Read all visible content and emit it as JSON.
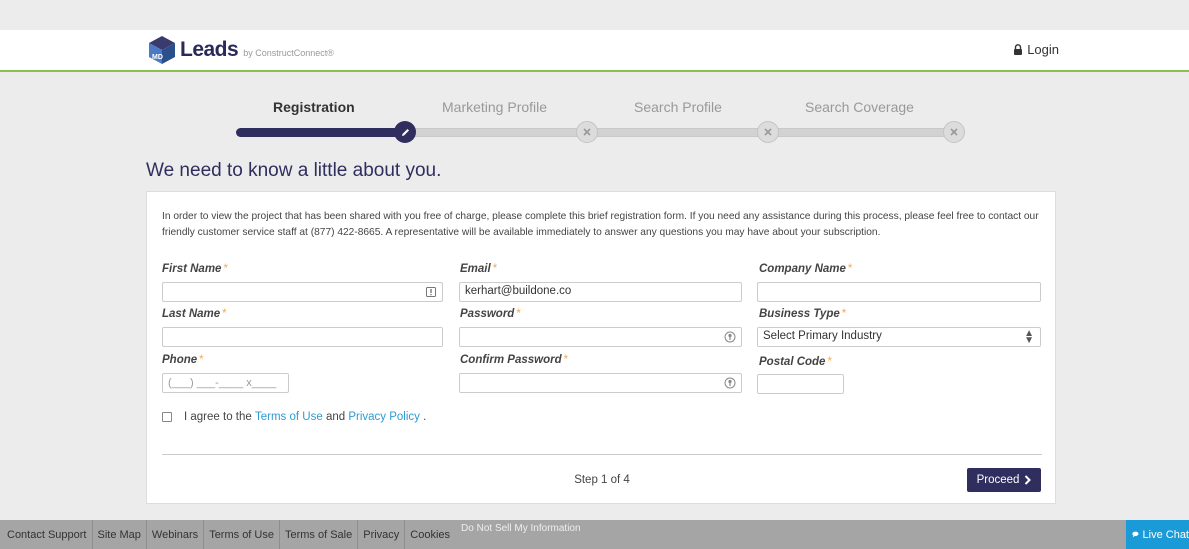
{
  "header": {
    "logo_word": "Leads",
    "logo_byline": "by ConstructConnect®",
    "logo_cube_letters": "MD",
    "login_label": "Login"
  },
  "steps": [
    {
      "label": "Registration",
      "state": "active"
    },
    {
      "label": "Marketing Profile",
      "state": "todo"
    },
    {
      "label": "Search Profile",
      "state": "todo"
    },
    {
      "label": "Search Coverage",
      "state": "todo"
    }
  ],
  "heading": "We need to know a little about you.",
  "intro": "In order to view the project that has been shared with you free of charge, please complete this brief registration form. If you need any assistance during this process, please feel free to contact our friendly customer service staff at (877) 422-8665. A representative will be available immediately to answer any questions you may have about your subscription.",
  "form": {
    "required_mark": "*",
    "first_name": {
      "label": "First Name",
      "value": ""
    },
    "last_name": {
      "label": "Last Name",
      "value": ""
    },
    "phone": {
      "label": "Phone",
      "mask": "(___) ___-____ x____"
    },
    "email": {
      "label": "Email",
      "value": "kerhart@buildone.co"
    },
    "password": {
      "label": "Password",
      "value": ""
    },
    "confirm_password": {
      "label": "Confirm Password",
      "value": ""
    },
    "company_name": {
      "label": "Company Name",
      "value": ""
    },
    "business_type": {
      "label": "Business Type",
      "selected": "Select Primary Industry"
    },
    "postal_code": {
      "label": "Postal Code",
      "value": ""
    }
  },
  "agree": {
    "prefix": "I agree to the",
    "terms_link": "Terms of Use",
    "and": "and",
    "privacy_link": "Privacy Policy",
    "suffix": "."
  },
  "step_indicator": "Step 1 of 4",
  "proceed_label": "Proceed",
  "footer": {
    "links": [
      "Contact Support",
      "Site Map",
      "Webinars",
      "Terms of Use",
      "Terms of Sale",
      "Privacy",
      "Cookies"
    ],
    "do_not_sell": "Do Not Sell My Information",
    "live_chat": "Live Chat"
  },
  "colors": {
    "brand_navy": "#2f2e5f",
    "accent_green": "#8cc152",
    "link_blue": "#2d9bd1",
    "required_orange": "#f4a85a",
    "live_chat_blue": "#1a9bd7"
  }
}
